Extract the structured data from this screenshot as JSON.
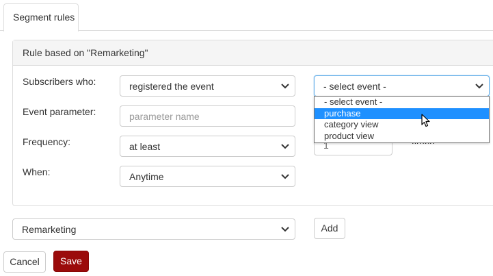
{
  "tabs": [
    {
      "label": "Segment rules"
    }
  ],
  "panel": {
    "title": "Rule based on \"Remarketing\""
  },
  "form": {
    "subscribers_label": "Subscribers who:",
    "subscribers_value": "registered the event",
    "event_select_value": "- select event -",
    "event_param_label": "Event parameter:",
    "event_param_placeholder": "parameter name",
    "frequency_label": "Frequency:",
    "frequency_value": "at least",
    "frequency_count": "1",
    "frequency_suffix": "times",
    "when_label": "When:",
    "when_value": "Anytime"
  },
  "event_dropdown": {
    "options": [
      "- select event -",
      "purchase",
      "category view",
      "product view"
    ],
    "highlighted": "purchase"
  },
  "bottom": {
    "segment_select_value": "Remarketing",
    "add_label": "Add"
  },
  "actions": {
    "cancel_label": "Cancel",
    "save_label": "Save"
  },
  "colors": {
    "accent": "#1e90ff",
    "save": "#9b0b0b",
    "focus": "#66afe9"
  }
}
